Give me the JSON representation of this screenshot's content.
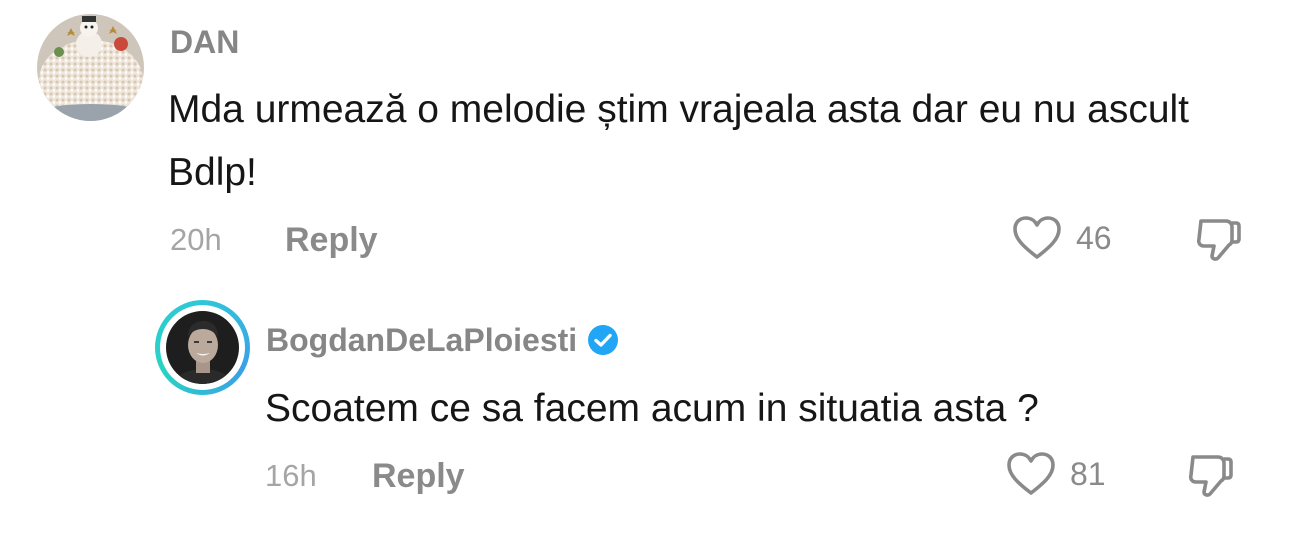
{
  "comments": [
    {
      "username": "DAN",
      "avatar_icon": "snowman-cake-photo",
      "text": "Mda urmează o melodie știm vrajeala asta dar eu nu ascult Bdlp!",
      "time": "20h",
      "reply_label": "Reply",
      "likes": "46",
      "like_icon": "heart-outline-icon",
      "dislike_icon": "thumbs-down-outline-icon"
    }
  ],
  "replies": [
    {
      "username": "BogdanDeLaPloiesti",
      "verified": true,
      "verified_color": "#20a6f4",
      "avatar_icon": "profile-photo",
      "avatar_ring_color": "#2fc7d8",
      "text": "Scoatem ce sa facem acum in situatia asta ?",
      "time": "16h",
      "reply_label": "Reply",
      "likes": "81",
      "like_icon": "heart-outline-icon",
      "dislike_icon": "thumbs-down-outline-icon"
    }
  ]
}
